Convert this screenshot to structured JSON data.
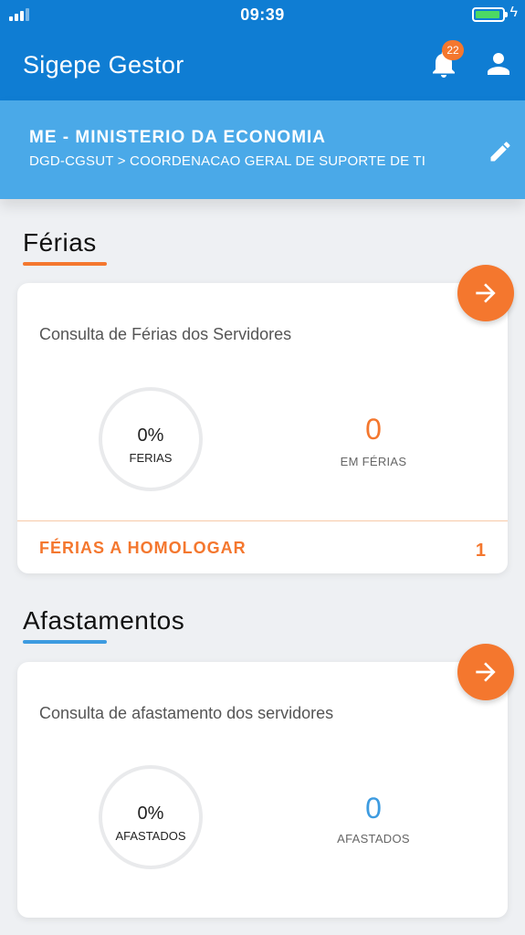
{
  "status_bar": {
    "time": "09:39"
  },
  "app_bar": {
    "title": "Sigepe Gestor",
    "notification_count": "22"
  },
  "org": {
    "name": "ME - MINISTERIO DA ECONOMIA",
    "unit": "DGD-CGSUT > COORDENACAO GERAL DE SUPORTE DE TI"
  },
  "ferias": {
    "section_title": "Férias",
    "card_subtitle": "Consulta de Férias dos Servidores",
    "ring_percent": "0%",
    "ring_label": "FERIAS",
    "count": "0",
    "count_label": "EM FÉRIAS",
    "homolog_label": "FÉRIAS A HOMOLOGAR",
    "homolog_count": "1"
  },
  "afastamentos": {
    "section_title": "Afastamentos",
    "card_subtitle": "Consulta de afastamento dos servidores",
    "ring_percent": "0%",
    "ring_label": "AFASTADOS",
    "count": "0",
    "count_label": "AFASTADOS"
  },
  "colors": {
    "app_bar": "#0f7dd3",
    "org_banner": "#4aa9e8",
    "accent_orange": "#f4772e",
    "accent_blue": "#3d9be0"
  },
  "icons": [
    "bell-icon",
    "user-icon",
    "edit-pencil-icon",
    "arrow-right-icon",
    "signal-icon",
    "battery-icon"
  ]
}
